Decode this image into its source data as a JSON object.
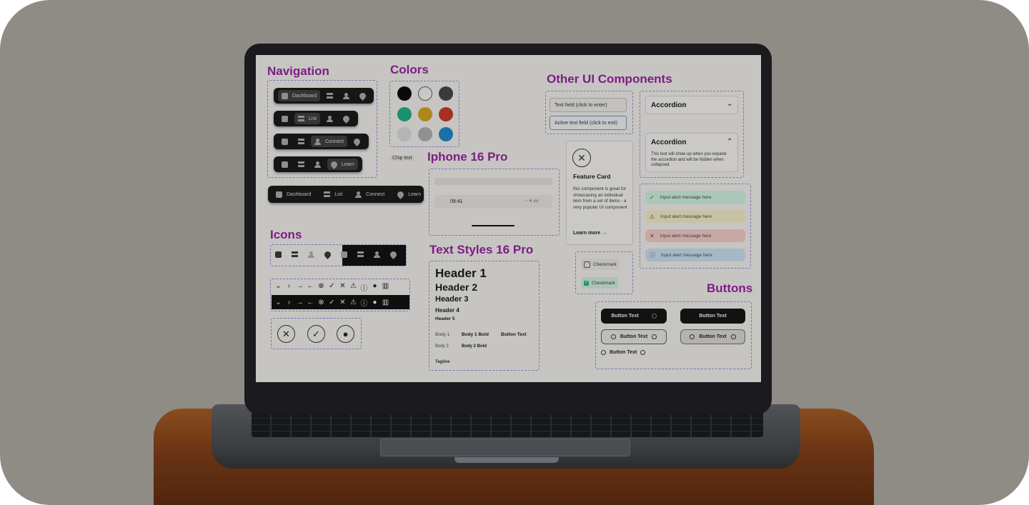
{
  "sections": {
    "navigation": "Navigation",
    "colors": "Colors",
    "other_ui": "Other UI Components",
    "iphone": "Iphone 16 Pro",
    "icons": "Icons",
    "text_styles": "Text Styles 16 Pro",
    "buttons": "Buttons"
  },
  "navigation": {
    "tabs": [
      "Dashboard",
      "List",
      "Connect",
      "Learn"
    ]
  },
  "colors": {
    "swatches": [
      "#0b0b0b",
      "#d9d9d9",
      "#3f3f3f",
      "#1e9e7a",
      "#b9951d",
      "#b3362a",
      "#c4c4c4",
      "#9e9e9e",
      "#1f7ab6"
    ],
    "chip_text": "Chip text"
  },
  "iphone": {
    "time": "09:41"
  },
  "text_styles": {
    "h1": "Header 1",
    "h2": "Header 2",
    "h3": "Header 3",
    "h4": "Header 4",
    "h5": "Header 5",
    "body1": "Body 1",
    "body1_bold": "Body 1 Bold",
    "button_text": "Button Text",
    "body2": "Body 2",
    "body2_bold": "Body 2 Bold",
    "tagline": "Tagline"
  },
  "fields": {
    "text_field": "Text field (click to enter)",
    "active_field": "Active text field (click to exit)"
  },
  "feature_card": {
    "title": "Feature Card",
    "body": "this component is great for showcasing an individual item from a set of items - a very popular UI component",
    "link": "Learn more"
  },
  "accordion": {
    "closed_title": "Accordion",
    "open_title": "Accordion",
    "open_body": "This text will show up when you expand the accordion and will be hidden when collapsed."
  },
  "alerts": [
    {
      "text": "Input alert message here",
      "color": "#b9d8c8",
      "icon": "check-icon"
    },
    {
      "text": "Input alert message here",
      "color": "#d9d3b4",
      "icon": "warning-icon"
    },
    {
      "text": "Input alert message here",
      "color": "#d9b6b4",
      "icon": "x-icon"
    },
    {
      "text": "Input alert message here",
      "color": "#b4c8d6",
      "icon": "info-icon"
    }
  ],
  "checkmarks": {
    "unchecked": "Checkmark",
    "checked": "Checkmark"
  },
  "buttons": {
    "label": "Button Text"
  }
}
